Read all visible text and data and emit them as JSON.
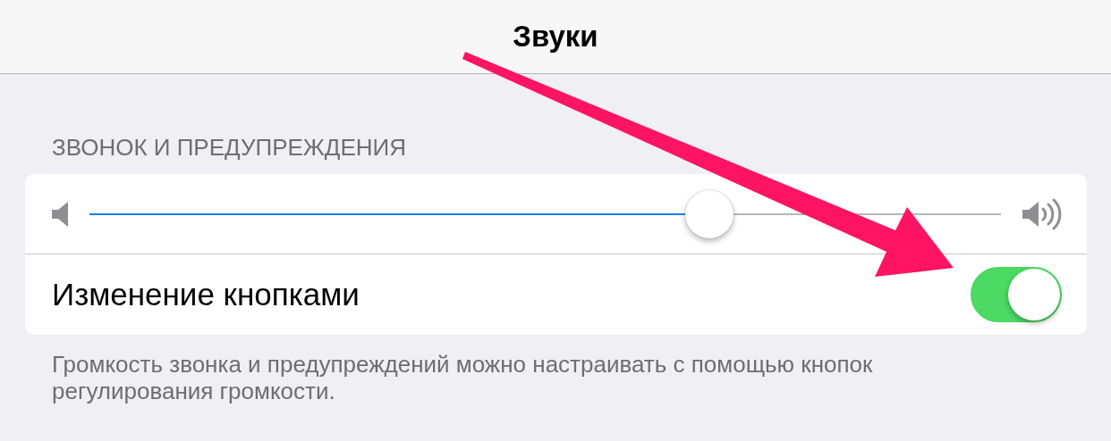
{
  "nav": {
    "title": "Звуки"
  },
  "section": {
    "header": "ЗВОНОК И ПРЕДУПРЕЖДЕНИЯ",
    "volume": {
      "level": 0.68
    },
    "change_with_buttons": {
      "label": "Изменение кнопками",
      "on": true
    },
    "footer": "Громкость звонка и предупреждений можно настраивать с помощью кнопок регулирования громкости."
  }
}
